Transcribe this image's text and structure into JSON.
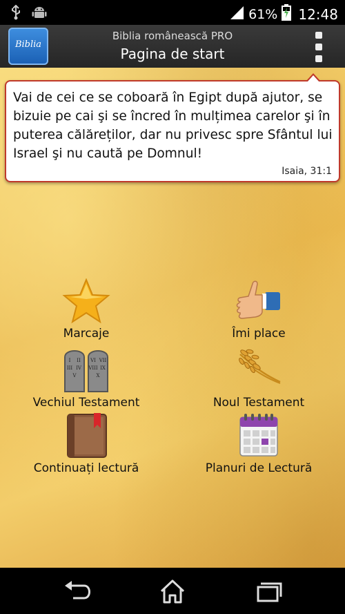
{
  "status_bar": {
    "battery_percent": "61%",
    "time": "12:48",
    "icons": [
      "usb-icon",
      "android-debug-icon",
      "signal-icon",
      "battery-charging-icon"
    ]
  },
  "app_bar": {
    "app_icon_text": "Biblia",
    "subtitle": "Biblia românească PRO",
    "title": "Pagina de start",
    "menu_icon": "overflow-menu-icon"
  },
  "verse": {
    "text": "Vai de cei ce se coboară în Egipt după ajutor, se bizuie pe cai şi se încred în mulțimea carelor şi în puterea călăreților, dar nu privesc spre Sfântul lui Israel şi nu caută pe Domnul!",
    "reference": "Isaia, 31:1"
  },
  "menu": [
    {
      "label": "Marcaje",
      "icon": "star-icon"
    },
    {
      "label": "Îmi place",
      "icon": "thumbs-up-icon"
    },
    {
      "label": "Vechiul Testament",
      "icon": "stone-tablets-icon"
    },
    {
      "label": "Noul Testament",
      "icon": "wheat-icon"
    },
    {
      "label": "Continuați lectură",
      "icon": "book-bookmark-icon"
    },
    {
      "label": "Planuri de Lectură",
      "icon": "calendar-icon"
    }
  ],
  "nav_bar": {
    "icons": [
      "back-icon",
      "home-icon",
      "recent-apps-icon"
    ]
  },
  "colors": {
    "verse_border": "#c0392b",
    "star": "#f5b01a",
    "calendar_header": "#8e44ad"
  }
}
